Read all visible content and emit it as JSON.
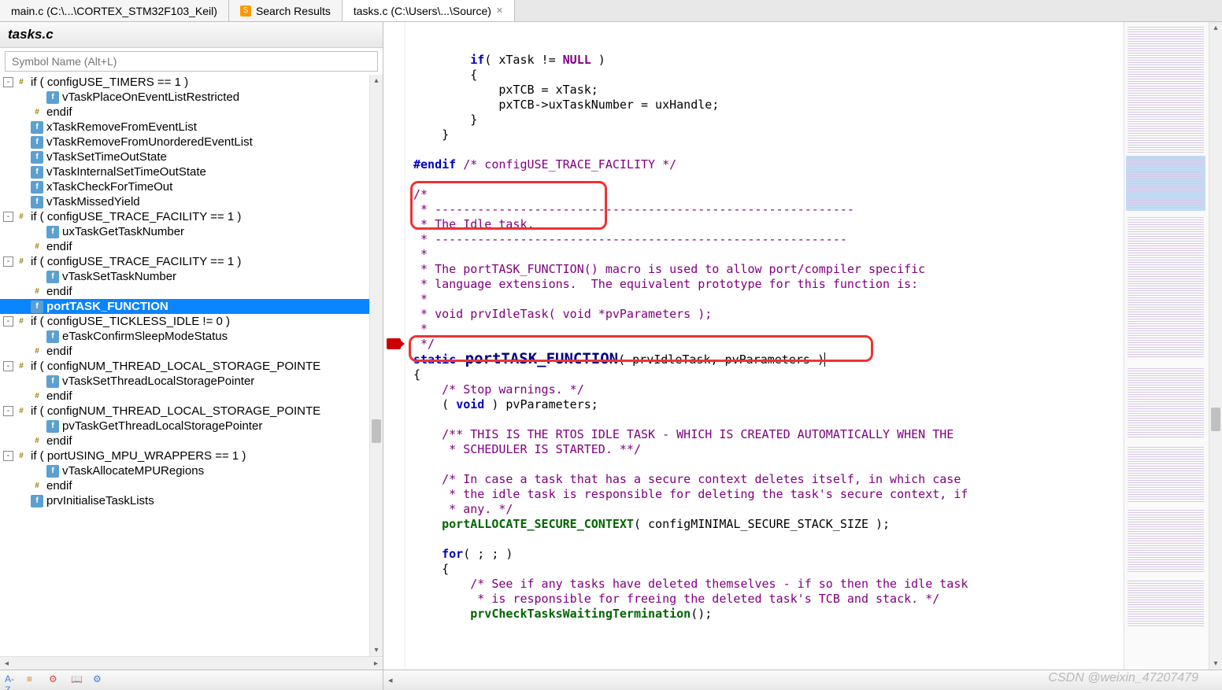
{
  "tabs": [
    {
      "label": "main.c (C:\\...\\CORTEX_STM32F103_Keil)"
    },
    {
      "label": "Search Results"
    },
    {
      "label": "tasks.c (C:\\Users\\...\\Source)"
    }
  ],
  "sidebar": {
    "title": "tasks.c",
    "search_placeholder": "Symbol Name (Alt+L)",
    "items": [
      {
        "exp": "-",
        "ind": 0,
        "ico": "hash",
        "label": "if ( configUSE_TIMERS == 1 )"
      },
      {
        "exp": "",
        "ind": 2,
        "ico": "f",
        "label": "vTaskPlaceOnEventListRestricted"
      },
      {
        "exp": "",
        "ind": 1,
        "ico": "hash",
        "label": "endif"
      },
      {
        "exp": "",
        "ind": 1,
        "ico": "f",
        "label": "xTaskRemoveFromEventList"
      },
      {
        "exp": "",
        "ind": 1,
        "ico": "f",
        "label": "vTaskRemoveFromUnorderedEventList"
      },
      {
        "exp": "",
        "ind": 1,
        "ico": "f",
        "label": "vTaskSetTimeOutState"
      },
      {
        "exp": "",
        "ind": 1,
        "ico": "f",
        "label": "vTaskInternalSetTimeOutState"
      },
      {
        "exp": "",
        "ind": 1,
        "ico": "f",
        "label": "xTaskCheckForTimeOut"
      },
      {
        "exp": "",
        "ind": 1,
        "ico": "f",
        "label": "vTaskMissedYield"
      },
      {
        "exp": "-",
        "ind": 0,
        "ico": "hash",
        "label": "if ( configUSE_TRACE_FACILITY == 1 )"
      },
      {
        "exp": "",
        "ind": 2,
        "ico": "f",
        "label": "uxTaskGetTaskNumber"
      },
      {
        "exp": "",
        "ind": 1,
        "ico": "hash",
        "label": "endif"
      },
      {
        "exp": "-",
        "ind": 0,
        "ico": "hash",
        "label": "if ( configUSE_TRACE_FACILITY == 1 )"
      },
      {
        "exp": "",
        "ind": 2,
        "ico": "f",
        "label": "vTaskSetTaskNumber"
      },
      {
        "exp": "",
        "ind": 1,
        "ico": "hash",
        "label": "endif"
      },
      {
        "exp": "",
        "ind": 1,
        "ico": "f",
        "label": "portTASK_FUNCTION",
        "selected": true
      },
      {
        "exp": "-",
        "ind": 0,
        "ico": "hash",
        "label": "if ( configUSE_TICKLESS_IDLE != 0 )"
      },
      {
        "exp": "",
        "ind": 2,
        "ico": "f",
        "label": "eTaskConfirmSleepModeStatus"
      },
      {
        "exp": "",
        "ind": 1,
        "ico": "hash",
        "label": "endif"
      },
      {
        "exp": "-",
        "ind": 0,
        "ico": "hash",
        "label": "if ( configNUM_THREAD_LOCAL_STORAGE_POINTE"
      },
      {
        "exp": "",
        "ind": 2,
        "ico": "f",
        "label": "vTaskSetThreadLocalStoragePointer"
      },
      {
        "exp": "",
        "ind": 1,
        "ico": "hash",
        "label": "endif"
      },
      {
        "exp": "-",
        "ind": 0,
        "ico": "hash",
        "label": "if ( configNUM_THREAD_LOCAL_STORAGE_POINTE"
      },
      {
        "exp": "",
        "ind": 2,
        "ico": "f",
        "label": "pvTaskGetThreadLocalStoragePointer"
      },
      {
        "exp": "",
        "ind": 1,
        "ico": "hash",
        "label": "endif"
      },
      {
        "exp": "-",
        "ind": 0,
        "ico": "hash",
        "label": "if ( portUSING_MPU_WRAPPERS == 1 )"
      },
      {
        "exp": "",
        "ind": 2,
        "ico": "f",
        "label": "vTaskAllocateMPURegions"
      },
      {
        "exp": "",
        "ind": 1,
        "ico": "hash",
        "label": "endif"
      },
      {
        "exp": "",
        "ind": 1,
        "ico": "f",
        "label": "prvInitialiseTaskLists"
      }
    ],
    "toolbar": [
      "A-Z",
      "≡",
      "⚙",
      "📖",
      "⚙"
    ]
  },
  "code": {
    "l1a": "        if",
    "l1b": "( xTask != ",
    "l1c": "NULL",
    "l1d": " )",
    "l2": "        {",
    "l3a": "            pxTCB = xTask;",
    "l4a": "            pxTCB->uxTaskNumber = uxHandle;",
    "l5": "        }",
    "l6": "    }",
    "l7": "",
    "l8a": "#endif",
    "l8b": " /* configUSE_TRACE_FACILITY */",
    "l9": "",
    "l10": "/*",
    "l11": " * -----------------------------------------------------------",
    "l12": " * The Idle task.",
    "l13": " * ----------------------------------------------------------",
    "l14": " *",
    "l15": " * The portTASK_FUNCTION() macro is used to allow port/compiler specific",
    "l16": " * language extensions.  The equivalent prototype for this function is:",
    "l17": " *",
    "l18": " * void prvIdleTask( void *pvParameters );",
    "l19": " *",
    "l20": " */",
    "l21a": "static",
    "l21b": " portTASK_FUNCTION",
    "l21c": "( prvIdleTask, pvParameters )",
    "l22": "{",
    "l23": "    /* Stop warnings. */",
    "l24a": "    ( ",
    "l24b": "void",
    "l24c": " ) pvParameters;",
    "l25": "",
    "l26": "    /** THIS IS THE RTOS IDLE TASK - WHICH IS CREATED AUTOMATICALLY WHEN THE",
    "l27": "     * SCHEDULER IS STARTED. **/",
    "l28": "",
    "l29": "    /* In case a task that has a secure context deletes itself, in which case",
    "l30": "     * the idle task is responsible for deleting the task's secure context, if",
    "l31": "     * any. */",
    "l32a": "    portALLOCATE_SECURE_CONTEXT",
    "l32b": "( configMINIMAL_SECURE_STACK_SIZE );",
    "l33": "",
    "l34a": "    for",
    "l34b": "( ; ; )",
    "l35": "    {",
    "l36": "        /* See if any tasks have deleted themselves - if so then the idle task",
    "l37": "         * is responsible for freeing the deleted task's TCB and stack. */",
    "l38a": "        prvCheckTasksWaitingTermination",
    "l38b": "();"
  },
  "watermark": "CSDN @weixin_47207479"
}
